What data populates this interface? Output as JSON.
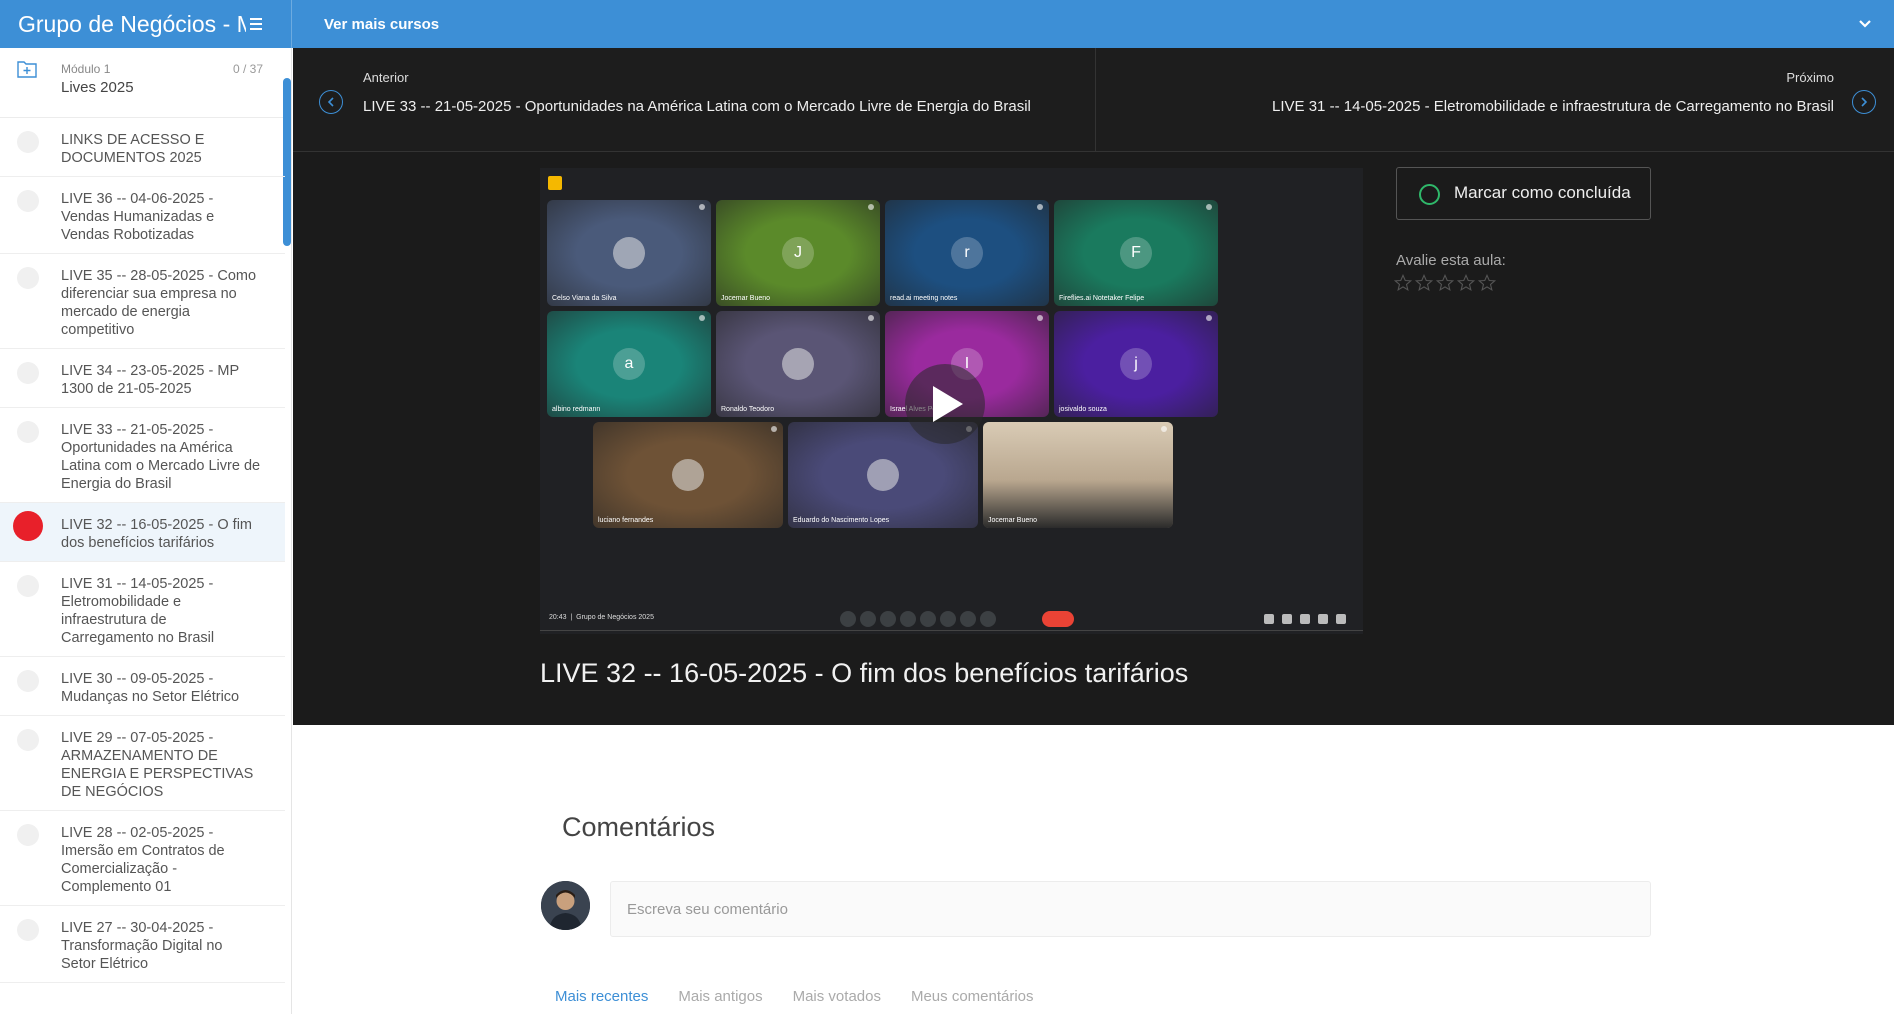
{
  "header": {
    "brand": "Grupo de Negócios - M",
    "more_courses": "Ver mais cursos",
    "accent": "#3d8fd6"
  },
  "sidebar": {
    "module_label": "Módulo 1",
    "module_name": "Lives 2025",
    "progress": "0 / 37",
    "items": [
      {
        "label": "LINKS DE ACESSO E DOCUMENTOS 2025"
      },
      {
        "label": "LIVE 36 -- 04-06-2025 - Vendas Humanizadas e Vendas Robotizadas"
      },
      {
        "label": "LIVE 35 -- 28-05-2025 - Como diferenciar sua empresa no mercado de energia competitivo"
      },
      {
        "label": "LIVE 34 -- 23-05-2025 - MP 1300 de 21-05-2025"
      },
      {
        "label": "LIVE 33 -- 21-05-2025 - Oportunidades na América Latina com o Mercado Livre de Energia do Brasil"
      },
      {
        "label": "LIVE 32 -- 16-05-2025 - O fim dos benefícios tarifários"
      },
      {
        "label": "LIVE 31 -- 14-05-2025 - Eletromobilidade e infraestrutura de Carregamento no Brasil"
      },
      {
        "label": "LIVE 30 -- 09-05-2025 - Mudanças no Setor Elétrico"
      },
      {
        "label": "LIVE 29 -- 07-05-2025 - ARMAZENAMENTO DE ENERGIA E PERSPECTIVAS DE NEGÓCIOS"
      },
      {
        "label": "LIVE 28 -- 02-05-2025 - Imersão em Contratos de Comercialização - Complemento 01"
      },
      {
        "label": "LIVE 27 -- 30-04-2025 - Transformação Digital no Setor Elétrico"
      }
    ]
  },
  "nav": {
    "prev_label": "Anterior",
    "prev_title": "LIVE 33 -- 21-05-2025 - Oportunidades na América Latina com o Mercado Livre de Energia do Brasil",
    "next_label": "Próximo",
    "next_title": "LIVE 31 -- 14-05-2025 - Eletromobilidade e infraestrutura de Carregamento no Brasil"
  },
  "video": {
    "participants": [
      {
        "name": "Celso Viana da Silva",
        "initial": "",
        "color": "#4a5a7a"
      },
      {
        "name": "Jocemar Bueno",
        "initial": "J",
        "color": "#5b8a2a"
      },
      {
        "name": "read.ai meeting notes",
        "initial": "r",
        "color": "#1d4f80"
      },
      {
        "name": "Fireflies.ai Notetaker Felipe",
        "initial": "F",
        "color": "#1a7a5e"
      },
      {
        "name": "albino redmann",
        "initial": "a",
        "color": "#1a8478"
      },
      {
        "name": "Ronaldo Teodoro",
        "initial": "",
        "color": "#5a5575"
      },
      {
        "name": "Israel Alves Pereira",
        "initial": "I",
        "color": "#9a2a9e"
      },
      {
        "name": "josivaldo souza",
        "initial": "j",
        "color": "#4b1fa0"
      },
      {
        "name": "luciano fernandes",
        "initial": "",
        "color": "#6e5236"
      },
      {
        "name": "Eduardo do Nascimento Lopes",
        "initial": "",
        "color": "#4a4a78"
      },
      {
        "name": "Jocemar Bueno",
        "initial": "",
        "color": "#b8a58a"
      }
    ],
    "time": "20:43",
    "meeting_name": "Grupo de Negócios 2025"
  },
  "lesson": {
    "title": "LIVE 32 -- 16-05-2025 - O fim dos benefícios tarifários",
    "complete_label": "Marcar como concluída",
    "rate_label": "Avalie esta aula:",
    "rating": 0,
    "max_rating": 5
  },
  "comments": {
    "title": "Comentários",
    "placeholder": "Escreva seu comentário",
    "tabs": [
      "Mais recentes",
      "Mais antigos",
      "Mais votados",
      "Meus comentários"
    ]
  }
}
